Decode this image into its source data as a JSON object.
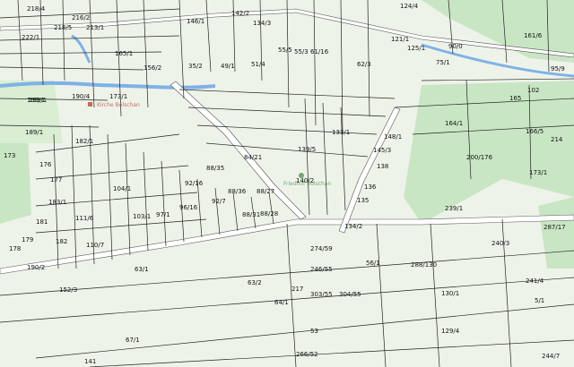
{
  "colors": {
    "background": "#eef3ea",
    "forest": "#c9e6c4",
    "grass": "#d9eed3",
    "water": "#7fb2e5",
    "road": "#ffffff",
    "boundary": "#222222"
  },
  "poi_labels": [
    {
      "text": "Friedhof Bolschan",
      "icon": "cemetery-icon"
    },
    {
      "text": "Kirche Bolschan",
      "icon": "church-icon"
    }
  ],
  "parcel_labels": [
    "218/4",
    "216/2",
    "213/1",
    "222/1",
    "218/5",
    "165/1",
    "156/2",
    "146/1",
    "142/2",
    "134/3",
    "124/4",
    "193/1",
    "190/4",
    "173/1",
    "35/2",
    "49/1",
    "51/4",
    "55/5",
    "55/3",
    "61/16",
    "62/3",
    "90/0",
    "161/6",
    "189/1",
    "182/1",
    "176",
    "173",
    "177",
    "183/1",
    "181",
    "179",
    "178",
    "182",
    "190/2",
    "152/3",
    "63/1",
    "63/2",
    "64/1",
    "67/1",
    "141",
    "148/1",
    "145/3",
    "138",
    "136",
    "135",
    "134/2",
    "164/1",
    "200/176",
    "173/1",
    "239/1",
    "240/3",
    "287/17",
    "288/130",
    "130/1",
    "129/4",
    "241/4",
    "244/7",
    "56/1",
    "53",
    "274/59",
    "246/55",
    "303/55",
    "304/55",
    "133/1",
    "139/5",
    "140/2",
    "84/21",
    "88/35",
    "92/16",
    "88/36",
    "88/27",
    "88/28",
    "88/31",
    "92/7",
    "96/16",
    "97/1",
    "104/1",
    "103/1",
    "111/6",
    "110/7",
    "217",
    "266/52",
    "193/1",
    "5/1",
    "95/9",
    "102",
    "165",
    "166/5",
    "214",
    "121/1",
    "125/1",
    "75/1"
  ]
}
